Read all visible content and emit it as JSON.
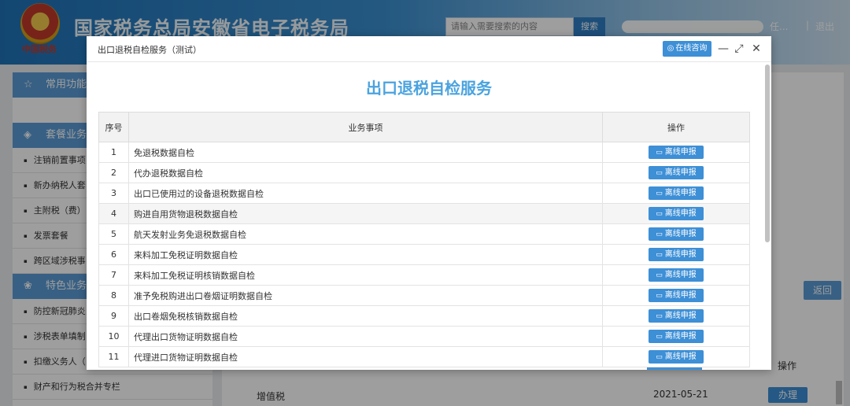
{
  "header": {
    "emblem_text": "中国税务",
    "site_title": "国家税务总局安徽省电子税务局",
    "search_placeholder": "请输入需要搜索的内容",
    "search_button": "搜索",
    "user_partial": "任...",
    "separator": "|",
    "logout": "退出"
  },
  "sidebar": {
    "sections": [
      {
        "label": "常用功能",
        "icon": "star-icon"
      },
      {
        "label": "套餐业务",
        "icon": "layers-icon"
      },
      {
        "label": "特色业务",
        "icon": "clover-icon"
      }
    ],
    "package_items": [
      "注销前置事项",
      "新办纳税人套",
      "主附税（费）",
      "发票套餐",
      "跨区域涉税事"
    ],
    "special_items": [
      "防控新冠肺炎",
      "涉税表单填制",
      "扣缴义务人（",
      "财产和行为税合并专栏"
    ]
  },
  "background": {
    "back_button": "返回",
    "op_header": "操作",
    "row_name": "增值税",
    "row_date": "2021-05-21",
    "row_button": "办理"
  },
  "dialog": {
    "title": "出口退税自检服务（测试）",
    "consult_button": "在线咨询",
    "heading": "出口退税自检服务",
    "columns": {
      "num": "序号",
      "item": "业务事项",
      "op": "操作"
    },
    "report_label": "离线申报",
    "rows": [
      {
        "num": "1",
        "name": "免退税数据自检"
      },
      {
        "num": "2",
        "name": "代办退税数据自检"
      },
      {
        "num": "3",
        "name": "出口已使用过的设备退税数据自检"
      },
      {
        "num": "4",
        "name": "购进自用货物退税数据自检"
      },
      {
        "num": "5",
        "name": "航天发射业务免退税数据自检"
      },
      {
        "num": "6",
        "name": "来料加工免税证明数据自检"
      },
      {
        "num": "7",
        "name": "来料加工免税证明核销数据自检"
      },
      {
        "num": "8",
        "name": "准予免税购进出口卷烟证明数据自检"
      },
      {
        "num": "9",
        "name": "出口卷烟免税核销数据自检"
      },
      {
        "num": "10",
        "name": "代理出口货物证明数据自检"
      },
      {
        "num": "11",
        "name": "代理进口货物证明数据自检"
      }
    ]
  }
}
